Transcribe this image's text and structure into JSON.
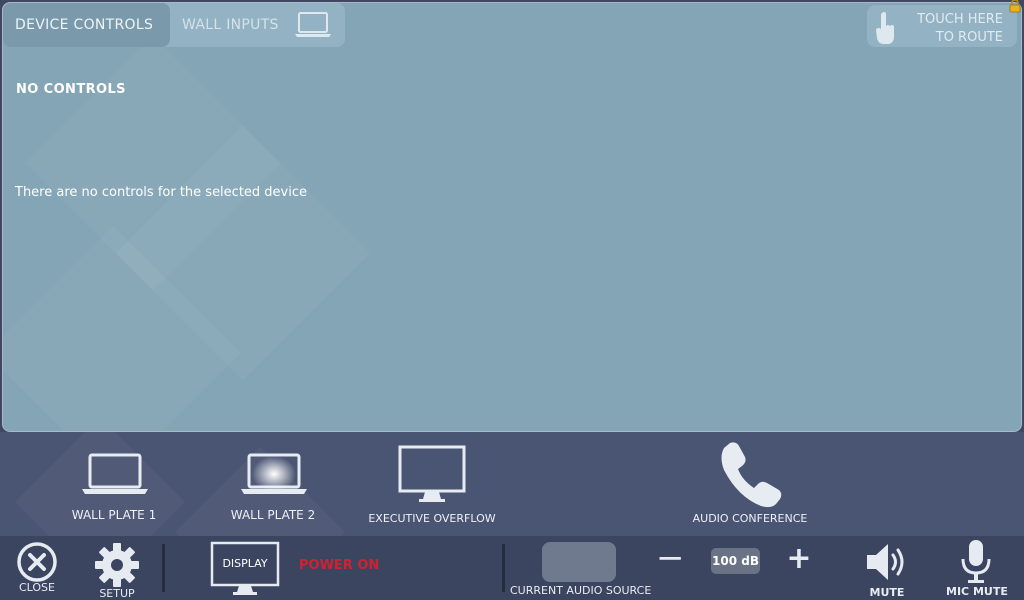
{
  "tabs": {
    "device_controls": "DEVICE CONTROLS",
    "wall_inputs": "WALL INPUTS"
  },
  "route_button": {
    "line1": "TOUCH HERE",
    "line2": "TO ROUTE"
  },
  "content": {
    "title": "NO CONTROLS",
    "message": "There are no controls for the selected device"
  },
  "sources": [
    {
      "label": "WALL PLATE 1",
      "icon": "laptop-icon"
    },
    {
      "label": "WALL PLATE 2",
      "icon": "laptop-icon",
      "selected": true
    },
    {
      "label": "EXECUTIVE OVERFLOW",
      "icon": "monitor-icon"
    },
    {
      "label": "AUDIO CONFERENCE",
      "icon": "phone-icon"
    }
  ],
  "bottom_bar": {
    "close_label": "CLOSE",
    "setup_label": "SETUP",
    "display_label": "DISPLAY",
    "power_status": "POWER ON",
    "audio_source_label": "CURRENT AUDIO SOURCE",
    "volume_minus": "−",
    "volume_level": "100 dB",
    "volume_plus": "+",
    "mute_label": "MUTE",
    "mic_mute_label": "MIC MUTE"
  },
  "colors": {
    "panel": "#84a5b6",
    "background": "#3f4863",
    "power_on": "#d3202f"
  }
}
